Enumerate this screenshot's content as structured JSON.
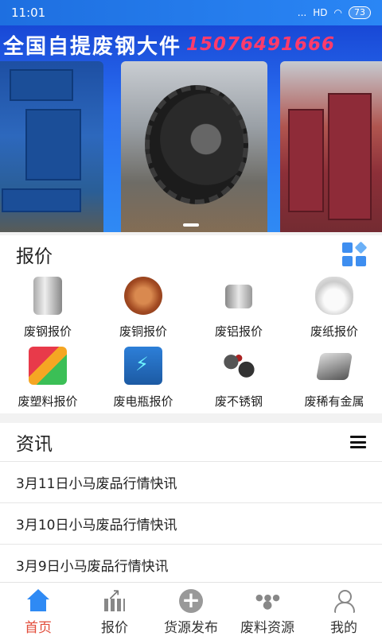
{
  "status_bar": {
    "time": "11:01",
    "signal": "...",
    "network": "HD",
    "battery": "73"
  },
  "banner": {
    "title": "全国自提废钢大件",
    "phone": "15076491666",
    "slides": [
      "machine-left",
      "gear-wheel",
      "steel-molds"
    ]
  },
  "quote_section": {
    "title": "报价",
    "items": [
      {
        "label": "废钢报价",
        "icon": "steel-icon"
      },
      {
        "label": "废铜报价",
        "icon": "copper-icon"
      },
      {
        "label": "废铝报价",
        "icon": "aluminum-icon"
      },
      {
        "label": "废纸报价",
        "icon": "paper-icon"
      },
      {
        "label": "废塑料报价",
        "icon": "plastic-icon"
      },
      {
        "label": "废电瓶报价",
        "icon": "battery-icon"
      },
      {
        "label": "废不锈钢",
        "icon": "stainless-steel-icon"
      },
      {
        "label": "废稀有金属",
        "icon": "rare-metal-icon"
      }
    ]
  },
  "news_section": {
    "title": "资讯",
    "items": [
      "3月11日小马废品行情快讯",
      "3月10日小马废品行情快讯",
      "3月9日小马废品行情快讯"
    ]
  },
  "bottom_nav": {
    "items": [
      {
        "label": "首页",
        "active": true
      },
      {
        "label": "报价",
        "active": false
      },
      {
        "label": "货源发布",
        "active": false
      },
      {
        "label": "废料资源",
        "active": false
      },
      {
        "label": "我的",
        "active": false
      }
    ]
  },
  "colors": {
    "accent": "#2f8af4",
    "active_nav": "#e24c3a",
    "banner_phone": "#ff3b6b"
  }
}
